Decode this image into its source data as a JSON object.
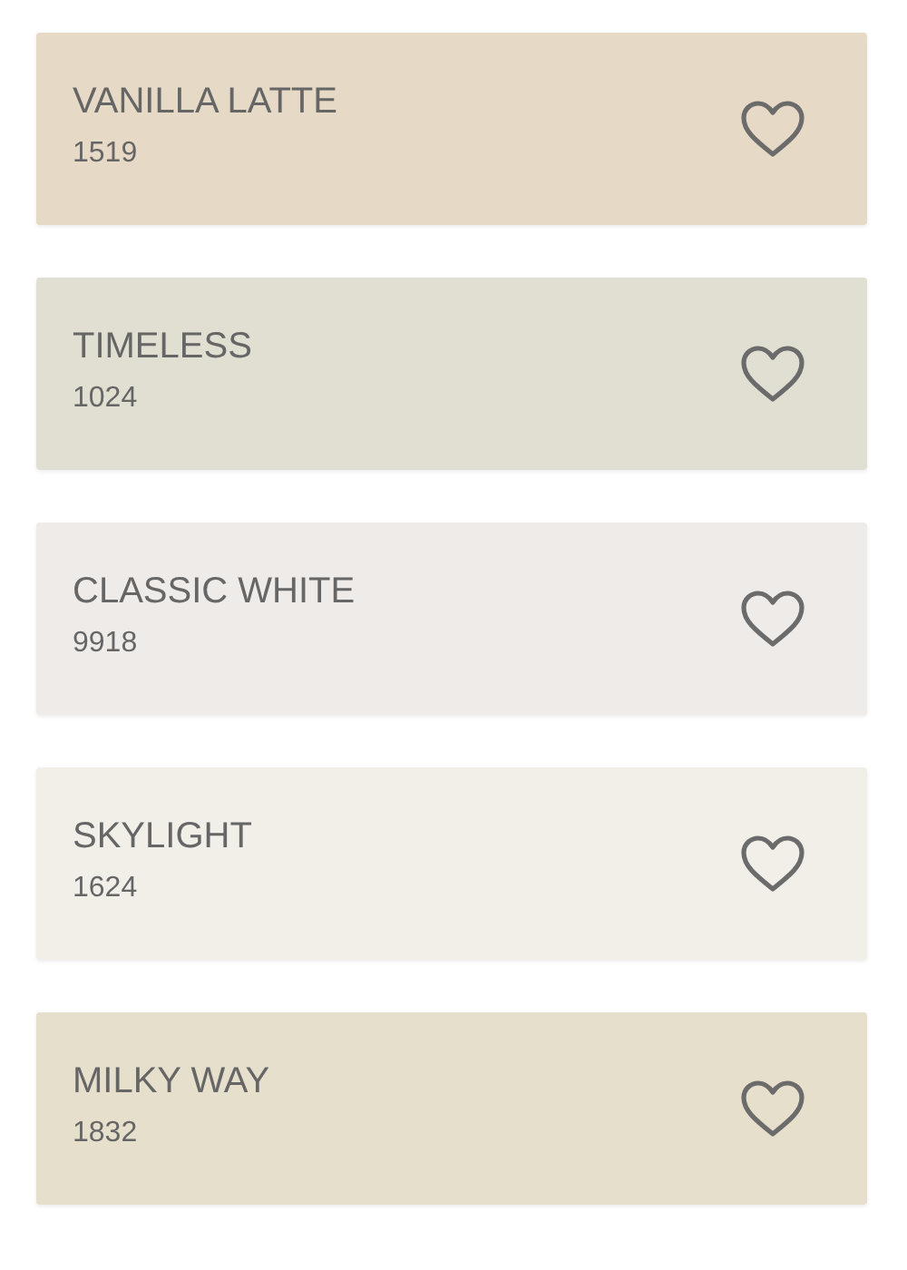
{
  "colors": [
    {
      "name": "VANILLA LATTE",
      "code": "1519",
      "color": "#e6d9c5",
      "favorite": false
    },
    {
      "name": "TIMELESS",
      "code": "1024",
      "color": "#e1ded2",
      "favorite": false
    },
    {
      "name": "CLASSIC WHITE",
      "code": "9918",
      "color": "#efebe8",
      "favorite": false
    },
    {
      "name": "SKYLIGHT",
      "code": "1624",
      "color": "#f2efe9",
      "favorite": false
    },
    {
      "name": "MILKY WAY",
      "code": "1832",
      "color": "#e6dfcc",
      "favorite": false
    }
  ]
}
